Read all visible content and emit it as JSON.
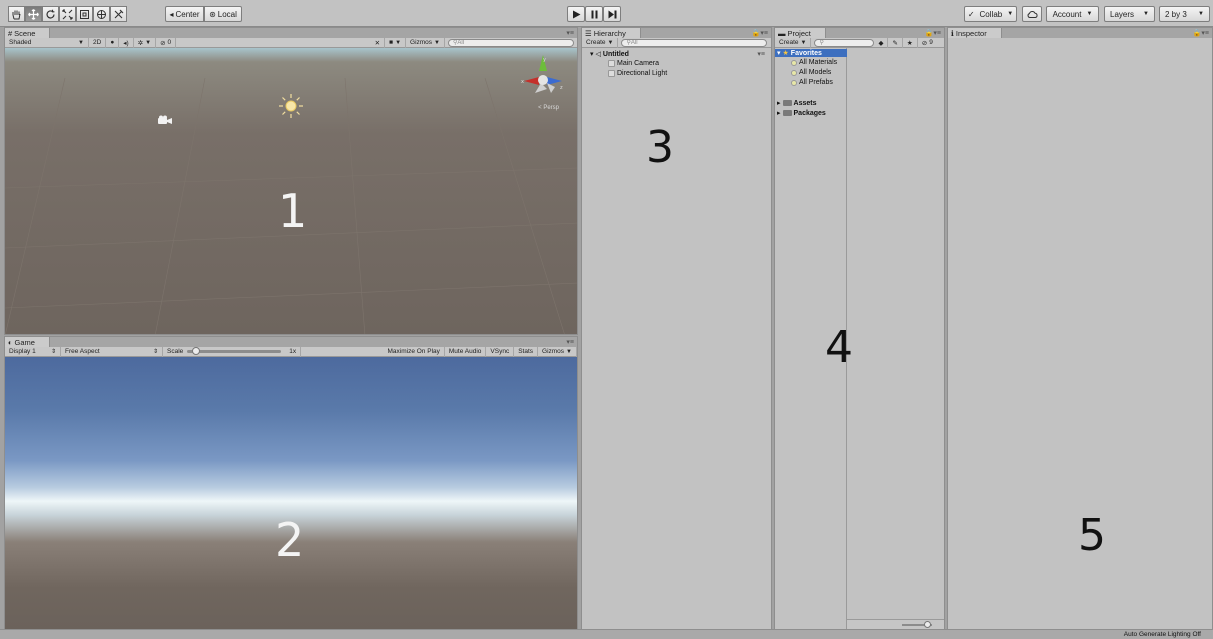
{
  "toolbar": {
    "tool_icons": [
      "hand-icon",
      "move-icon",
      "rotate-icon",
      "scale-icon",
      "rect-icon",
      "transform-icon",
      "custom-tool-icon"
    ],
    "center_label": "Center",
    "local_label": "Local",
    "collab_label": "Collab",
    "account_label": "Account",
    "layers_label": "Layers",
    "layout_label": "2 by 3"
  },
  "scene": {
    "tab_label": "Scene",
    "shaded_label": "Shaded",
    "toggle_2d": "2D",
    "hidden_count": "0",
    "gizmos_label": "Gizmos",
    "search_placeholder": "All",
    "persp_label": "Persp",
    "number": "1"
  },
  "game": {
    "tab_label": "Game",
    "display_label": "Display 1",
    "aspect_label": "Free Aspect",
    "scale_label": "Scale",
    "scale_value": "1x",
    "scale_slider_level": 0.05,
    "maximize_label": "Maximize On Play",
    "mute_label": "Mute Audio",
    "vsync_label": "VSync",
    "stats_label": "Stats",
    "gizmos_label": "Gizmos",
    "number": "2"
  },
  "hierarchy": {
    "tab_label": "Hierarchy",
    "create_label": "Create",
    "search_placeholder": "All",
    "scene_name": "Untitled",
    "items": [
      "Main Camera",
      "Directional Light"
    ],
    "number": "3"
  },
  "project": {
    "tab_label": "Project",
    "create_label": "Create",
    "hidden_count": "9",
    "favorites_label": "Favorites",
    "favorites": [
      "All Materials",
      "All Models",
      "All Prefabs"
    ],
    "folders": [
      "Assets",
      "Packages"
    ],
    "number": "4"
  },
  "inspector": {
    "tab_label": "Inspector",
    "number": "5"
  },
  "status": {
    "text": "Auto Generate Lighting Off"
  }
}
